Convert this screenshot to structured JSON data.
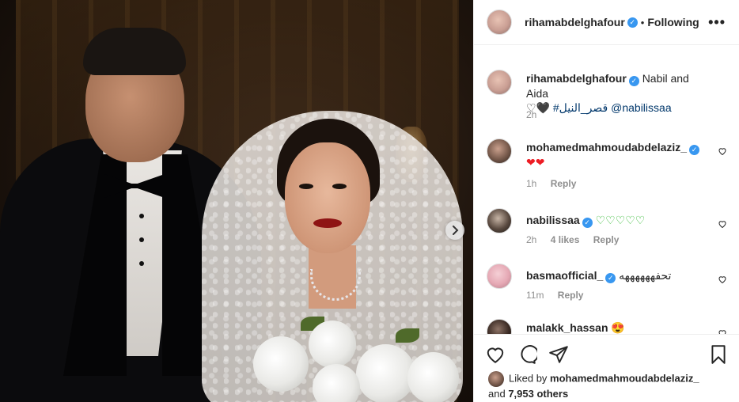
{
  "post": {
    "author": "rihamabdelghafour",
    "follow_status": "Following",
    "separator": "•",
    "more_label": "•••"
  },
  "caption": {
    "username": "rihamabdelghafour",
    "text": "Nabil and Aida",
    "mention": "@nabilissaa",
    "hashtag": "#قصر_النيل",
    "emoji": "♡🖤",
    "time": "2h"
  },
  "comments": [
    {
      "username": "mohamedmahmoudabdelaziz_",
      "verified": true,
      "text": "❤❤",
      "time": "1h",
      "likes": "",
      "reply_label": "Reply"
    },
    {
      "username": "nabilissaa",
      "verified": true,
      "text": "♡♡♡♡♡",
      "time": "2h",
      "likes": "4 likes",
      "reply_label": "Reply"
    },
    {
      "username": "basmaofficial_",
      "verified": true,
      "text": "تحفههههههه",
      "time": "11m",
      "likes": "",
      "reply_label": "Reply"
    },
    {
      "username": "malakk_hassan",
      "verified": false,
      "text": "😍",
      "time": "",
      "likes": "",
      "reply_label": ""
    }
  ],
  "likes": {
    "prefix": "Liked by",
    "user": "mohamedmahmoudabdelaziz_",
    "conjunction": "and",
    "others": "7,953 others"
  },
  "icons": {
    "like": "heart-outline-icon",
    "comment": "comment-bubble-icon",
    "share": "paper-plane-icon",
    "save": "bookmark-icon",
    "next": "chevron-right-icon"
  },
  "colors": {
    "verified": "#3897f0",
    "link": "#00376b",
    "muted": "#8e8e8e",
    "red_heart": "#ed1c24",
    "green_heart": "#1db21d"
  }
}
